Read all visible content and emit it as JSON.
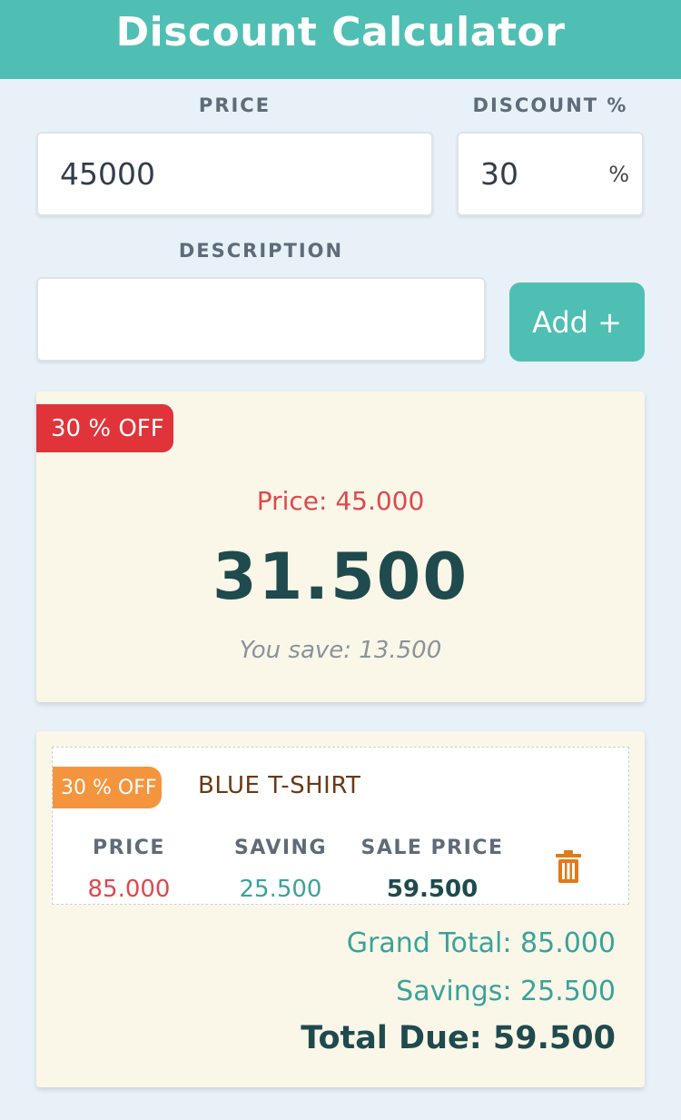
{
  "header": {
    "title": "Discount Calculator"
  },
  "form": {
    "price_label": "PRICE",
    "price_value": "45000",
    "discount_label": "DISCOUNT %",
    "discount_value": "30",
    "discount_suffix": "%",
    "description_label": "DESCRIPTION",
    "description_value": "",
    "add_label": "Add +"
  },
  "result": {
    "badge": "30 % OFF",
    "price_text": "Price: 45.000",
    "sale_price": "31.500",
    "save_text": "You save: 13.500"
  },
  "items": [
    {
      "badge": "30 % OFF",
      "name": "BLUE T-SHIRT",
      "price_label": "PRICE",
      "saving_label": "SAVING",
      "sale_label": "SALE PRICE",
      "price": "85.000",
      "saving": "25.500",
      "sale": "59.500",
      "delete_icon": "trash-icon"
    }
  ],
  "totals": {
    "grand_total": "Grand Total: 85.000",
    "savings": "Savings: 25.500",
    "total_due": "Total Due: 59.500"
  },
  "colors": {
    "accent": "#4fbfb3",
    "badge_red": "#e0343a",
    "badge_orange": "#f4953e",
    "price_red": "#e0484d",
    "saving_teal": "#3aa39a",
    "dark_teal": "#1f4a4e"
  }
}
